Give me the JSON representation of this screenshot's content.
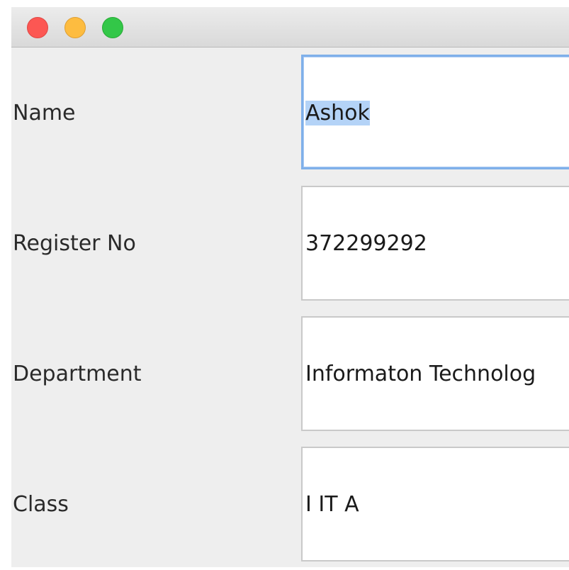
{
  "window": {
    "traffic_lights": {
      "close_color": "#fc5753",
      "minimize_color": "#fdbc40",
      "maximize_color": "#33c748"
    }
  },
  "form": {
    "fields": [
      {
        "label": "Name",
        "value": "Ashok",
        "focused": true,
        "selected": true
      },
      {
        "label": "Register No",
        "value": "372299292"
      },
      {
        "label": "Department",
        "value": "Informaton Technolog"
      },
      {
        "label": "Class",
        "value": "I IT A"
      }
    ]
  }
}
